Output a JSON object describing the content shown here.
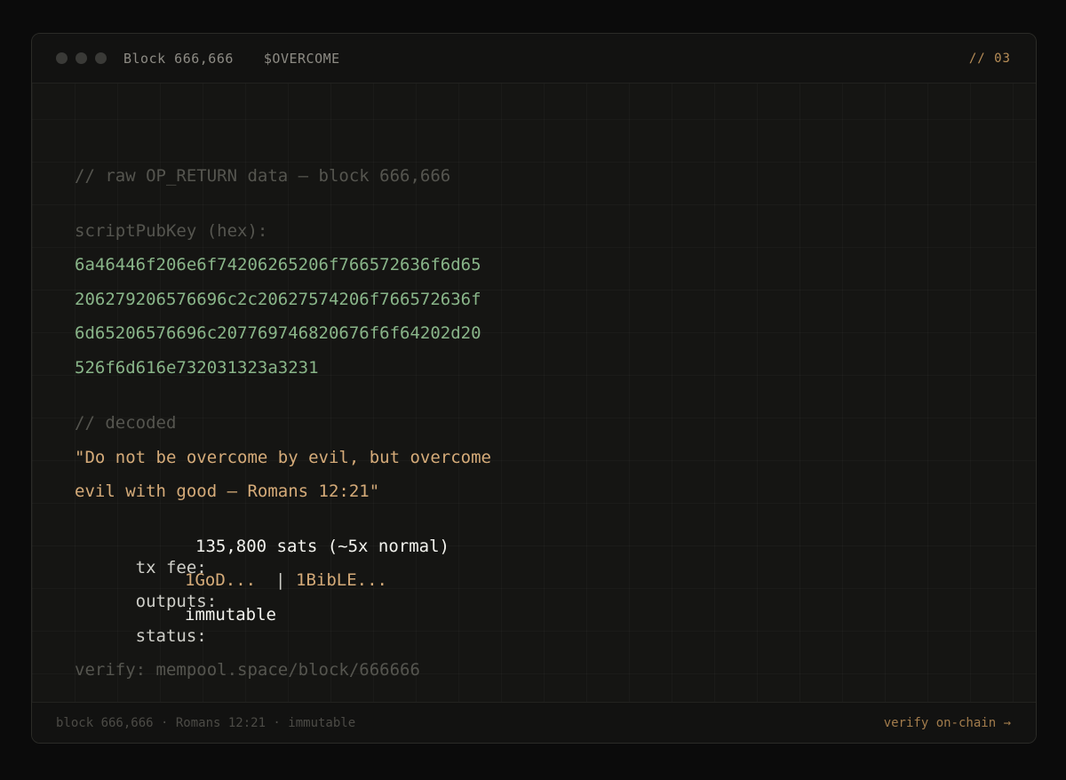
{
  "window": {
    "title": "Block 666,666",
    "ticker": "$OVERCOME",
    "page_number": "// 03"
  },
  "content": {
    "header_comment": "// raw OP_RETURN data — block 666,666",
    "script_label": "scriptPubKey (hex):",
    "hex_lines": [
      "6a46446f206e6f74206265206f766572636f6d65",
      "206279206576696c2c20627574206f766572636f",
      "6d65206576696c207769746820676f6f64202d20",
      "526f6d616e732031323a3231"
    ],
    "decoded_comment": "// decoded",
    "decoded_lines": [
      "\"Do not be overcome by evil, but overcome",
      "evil with good — Romans 12:21\""
    ],
    "tx_fee": {
      "label": "tx fee:",
      "value": "135,800 sats (~5x normal)"
    },
    "outputs": {
      "label": "outputs:",
      "first": "1GoD...",
      "separator": "|",
      "second": "1BibLE..."
    },
    "status": {
      "label": "status:",
      "value": "immutable"
    },
    "verify": "verify: mempool.space/block/666666"
  },
  "footer": {
    "left": "block 666,666 · Romans 12:21 · immutable",
    "right": "verify on-chain →"
  },
  "colors": {
    "background": "#0b0b0b",
    "panel": "#151513",
    "hex_green": "#89b589",
    "accent_tan": "#d5ab79",
    "comment_gray": "#55554f"
  }
}
